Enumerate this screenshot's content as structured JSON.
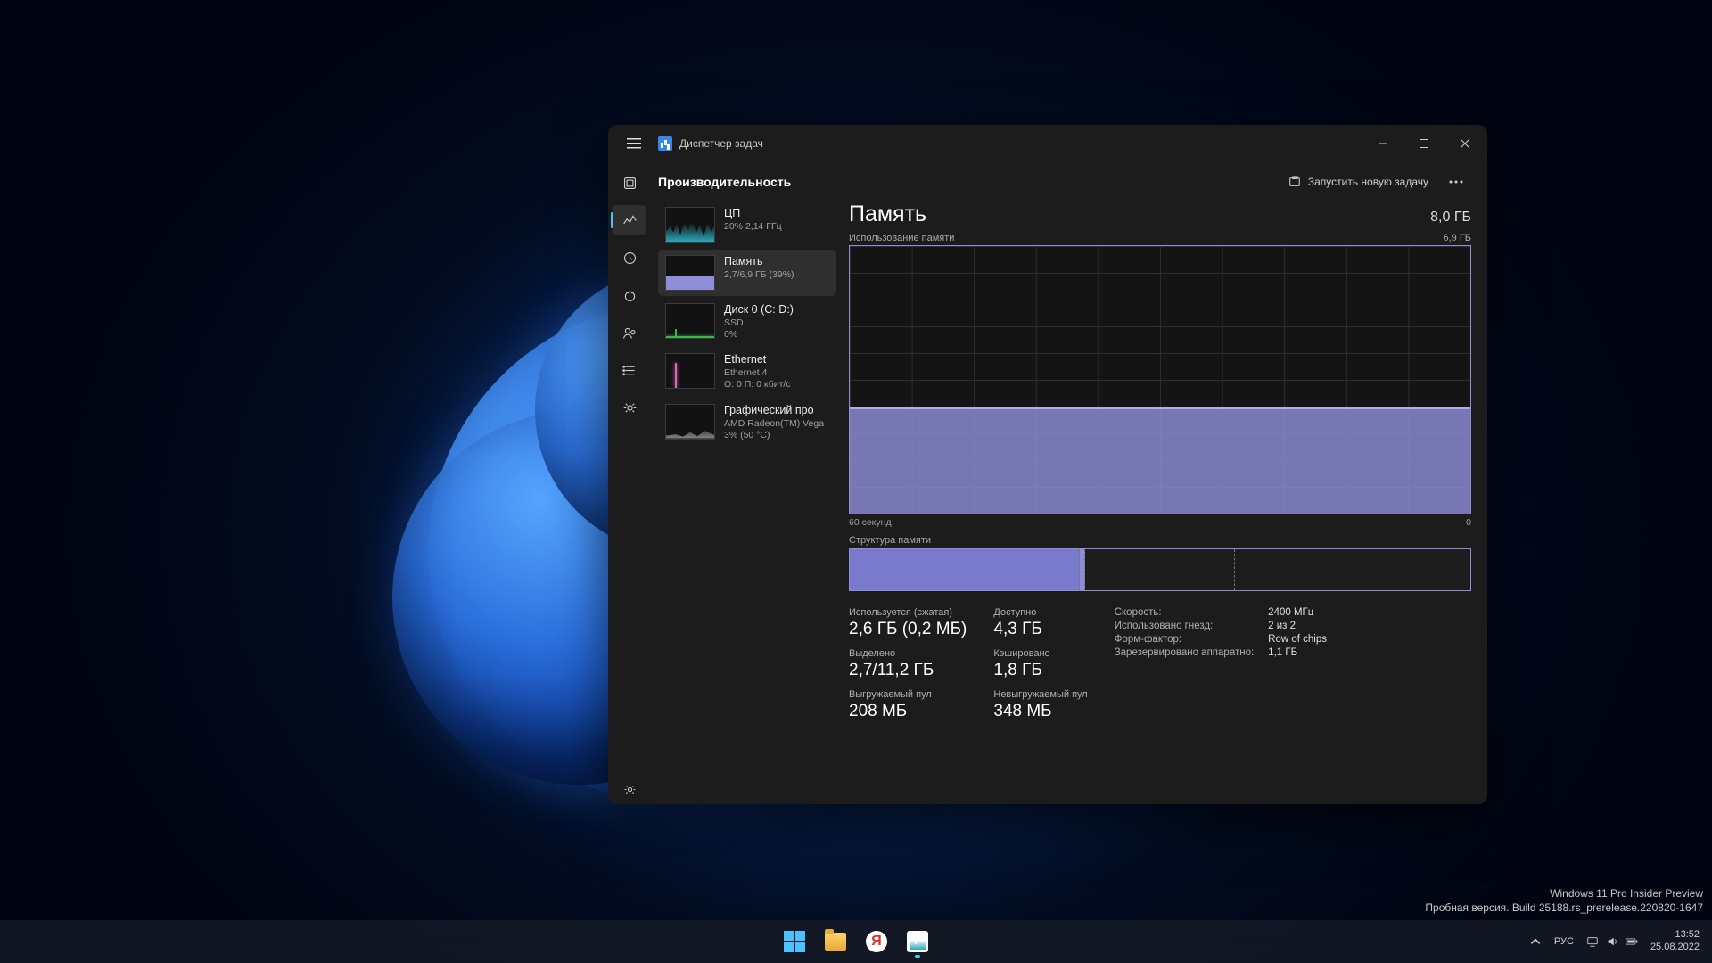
{
  "window": {
    "title": "Диспетчер задач",
    "section": "Производительность",
    "run_task": "Запустить новую задачу"
  },
  "list": {
    "cpu": {
      "title": "ЦП",
      "sub": "20% 2,14 ГГц"
    },
    "mem": {
      "title": "Память",
      "sub": "2,7/6,9 ГБ (39%)"
    },
    "disk": {
      "title": "Диск 0 (C: D:)",
      "sub1": "SSD",
      "sub2": "0%"
    },
    "net": {
      "title": "Ethernet",
      "sub1": "Ethernet 4",
      "sub2": "О: 0 П: 0 кбит/с"
    },
    "gpu": {
      "title": "Графический про",
      "sub1": "AMD Radeon(TM) Vega",
      "sub2": "3%  (50 °C)"
    }
  },
  "detail": {
    "title": "Память",
    "capacity": "8,0 ГБ",
    "usage_label": "Использование памяти",
    "usage_max": "6,9 ГБ",
    "x_left": "60 секунд",
    "x_right": "0",
    "composition_label": "Структура памяти",
    "stats": {
      "in_use_label": "Используется (сжатая)",
      "in_use": "2,6 ГБ (0,2 МБ)",
      "avail_label": "Доступно",
      "avail": "4,3 ГБ",
      "committed_label": "Выделено",
      "committed": "2,7/11,2 ГБ",
      "cached_label": "Кэшировано",
      "cached": "1,8 ГБ",
      "paged_label": "Выгружаемый пул",
      "paged": "208 МБ",
      "nonpaged_label": "Невыгружаемый пул",
      "nonpaged": "348 МБ"
    },
    "kv": {
      "speed_k": "Скорость:",
      "speed_v": "2400 МГц",
      "slots_k": "Использовано гнезд:",
      "slots_v": "2 из 2",
      "form_k": "Форм-фактор:",
      "form_v": "Row of chips",
      "hw_k": "Зарезервировано аппаратно:",
      "hw_v": "1,1 ГБ"
    }
  },
  "chart_data": {
    "type": "area",
    "title": "Использование памяти",
    "ylabel": "ГБ",
    "ylim": [
      0,
      6.9
    ],
    "x": [
      "-60с",
      "-55",
      "-50",
      "-45",
      "-40",
      "-35",
      "-30",
      "-25",
      "-20",
      "-15",
      "-10",
      "-5",
      "0"
    ],
    "values": [
      2.7,
      2.7,
      2.68,
      2.7,
      2.72,
      2.7,
      2.69,
      2.71,
      2.7,
      2.7,
      2.69,
      2.7,
      2.7
    ]
  },
  "watermark": {
    "l1": "Windows 11 Pro Insider Preview",
    "l2": "Пробная версия. Build 25188.rs_prerelease.220820-1647"
  },
  "taskbar": {
    "lang": "РУС",
    "time": "13:52",
    "date": "25.08.2022"
  }
}
